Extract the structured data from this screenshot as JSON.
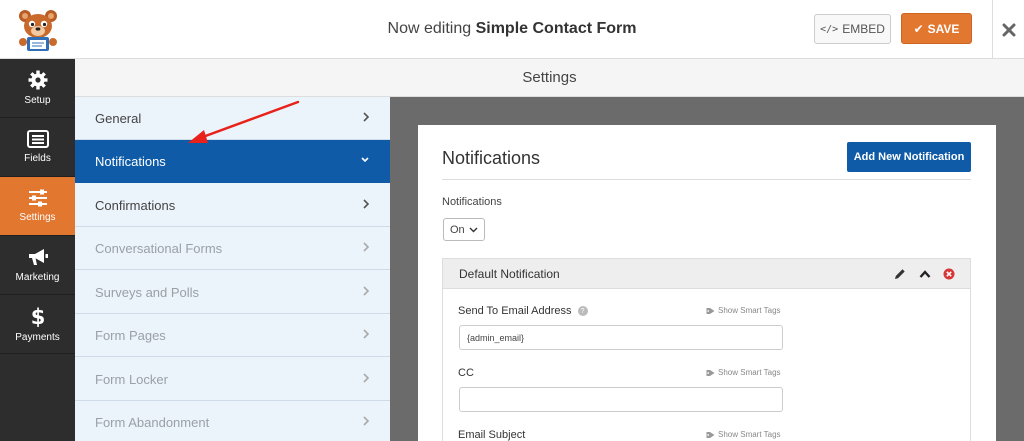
{
  "header": {
    "editing_prefix": "Now editing",
    "form_name": "Simple Contact Form",
    "embed_label": "EMBED",
    "save_label": "SAVE"
  },
  "leftnav": {
    "items": [
      {
        "label": "Setup",
        "icon": "gear-icon"
      },
      {
        "label": "Fields",
        "icon": "fields-list-icon"
      },
      {
        "label": "Settings",
        "icon": "sliders-icon"
      },
      {
        "label": "Marketing",
        "icon": "megaphone-icon"
      },
      {
        "label": "Payments",
        "icon": "dollar-icon"
      }
    ],
    "active": "Settings"
  },
  "settings_bar": {
    "title": "Settings"
  },
  "panels": [
    {
      "label": "General",
      "state": "normal"
    },
    {
      "label": "Notifications",
      "state": "active"
    },
    {
      "label": "Confirmations",
      "state": "normal"
    },
    {
      "label": "Conversational Forms",
      "state": "disabled"
    },
    {
      "label": "Surveys and Polls",
      "state": "disabled"
    },
    {
      "label": "Form Pages",
      "state": "disabled"
    },
    {
      "label": "Form Locker",
      "state": "disabled"
    },
    {
      "label": "Form Abandonment",
      "state": "disabled"
    }
  ],
  "content": {
    "title": "Notifications",
    "add_button": "Add New Notification",
    "toggle_label": "Notifications",
    "toggle_value": "On",
    "notification": {
      "title": "Default Notification",
      "fields": [
        {
          "label": "Send To Email Address",
          "value": "{admin_email}",
          "smart_tags": "Show Smart Tags"
        },
        {
          "label": "CC",
          "value": "",
          "smart_tags": "Show Smart Tags"
        },
        {
          "label": "Email Subject",
          "value": "",
          "smart_tags": "Show Smart Tags"
        }
      ]
    }
  },
  "colors": {
    "accent_orange": "#e27730",
    "active_blue": "#0f5ba7",
    "nav_dark": "#2d2d2d",
    "panel_bg": "#ebf3fb",
    "annotation_red": "#e8221b"
  }
}
